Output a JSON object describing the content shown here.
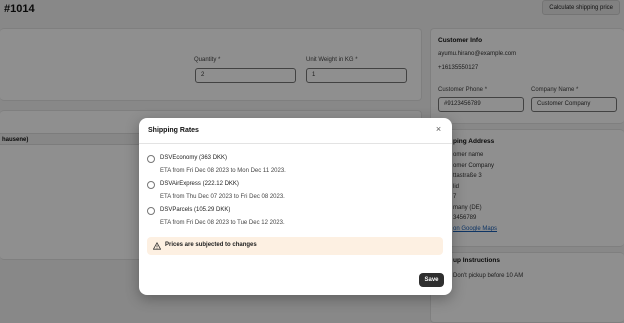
{
  "header": {
    "order_number": "#1014",
    "calculate_shipping_label": "Calculate shipping price"
  },
  "line_item": {
    "quantity_label": "Quantity *",
    "quantity_value": "2",
    "unit_weight_label": "Unit Weight in KG *",
    "unit_weight_value": "1",
    "row_fragment": "hausene)"
  },
  "customer": {
    "title": "Customer Info",
    "email": "ayumu.hirano@example.com",
    "phone": "+16135550127",
    "phone_label": "Customer Phone *",
    "phone_value": "#9123456789",
    "company_label": "Company Name *",
    "company_value": "Customer Company"
  },
  "shipping_address": {
    "title": "ping Address",
    "lines": [
      "omer name",
      "omer Company",
      "ttastraße 3",
      "lid",
      "7",
      "many (DE)",
      "3456789"
    ],
    "map_link": "on Google Maps"
  },
  "pickup": {
    "title": "up Instructions",
    "note": "Don't pickup before 10 AM"
  },
  "modal": {
    "title": "Shipping Rates",
    "close_glyph": "×",
    "options": [
      {
        "label": "DSVEconomy (363 DKK)",
        "eta": "ETA from Fri Dec 08 2023 to Mon Dec 11 2023."
      },
      {
        "label": "DSVAirExpress (222.12 DKK)",
        "eta": "ETA from Thu Dec 07 2023 to Fri Dec 08 2023."
      },
      {
        "label": "DSVParcels (105.29 DKK)",
        "eta": "ETA from Fri Dec 08 2023 to Tue Dec 12 2023."
      }
    ],
    "warning": "Prices are subjected to changes",
    "save_label": "Save"
  },
  "colors": {
    "overlay": "#000000",
    "warning_bg": "#fdf0e2",
    "save_bg": "#2f2f2f",
    "link": "#1a5fb4"
  },
  "icons": [
    "close-icon",
    "warning-icon",
    "radio-icon"
  ]
}
